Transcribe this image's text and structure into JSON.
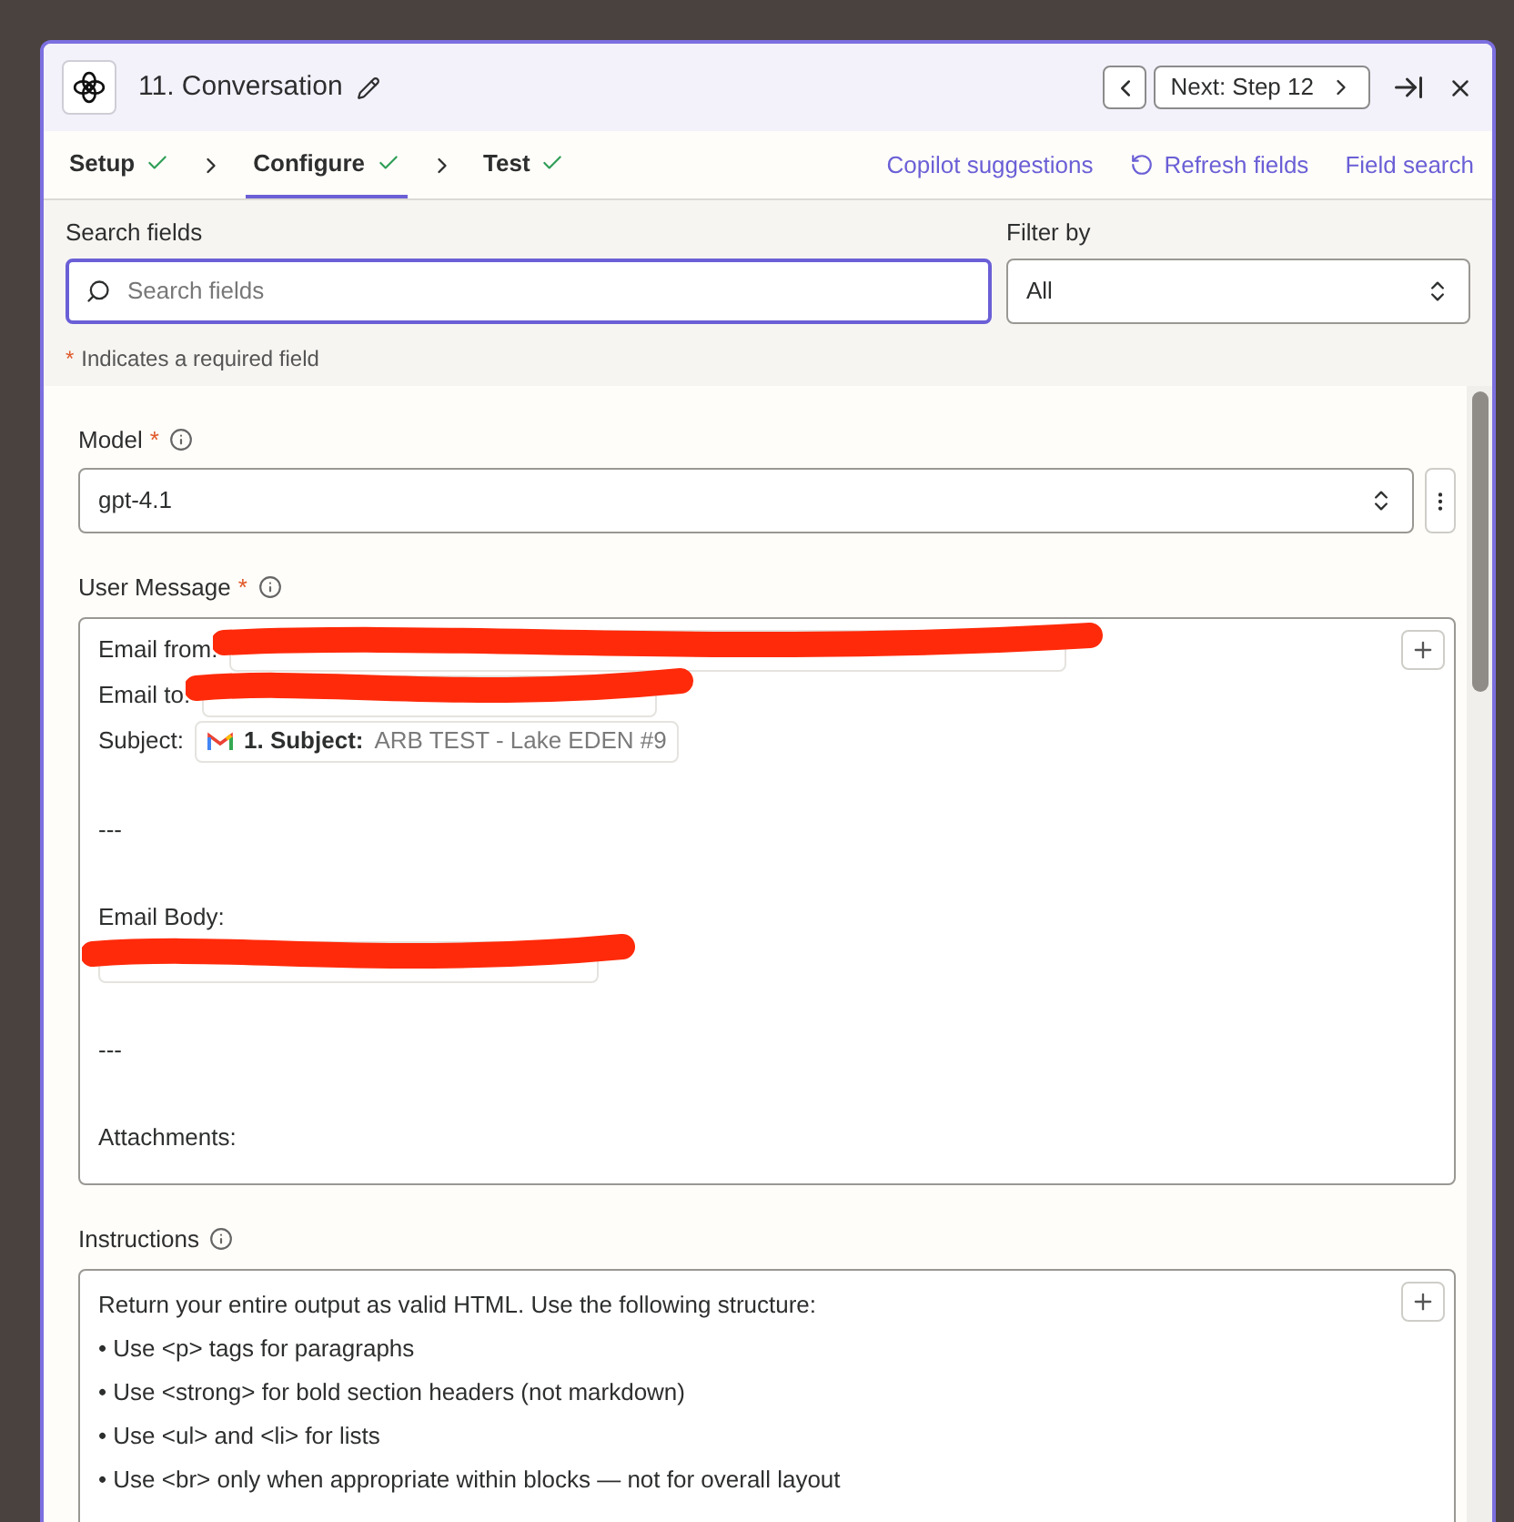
{
  "header": {
    "title": "11. Conversation",
    "next_button": "Next: Step 12"
  },
  "steps": [
    {
      "label": "Setup",
      "done": true,
      "selected": false
    },
    {
      "label": "Configure",
      "done": true,
      "selected": true
    },
    {
      "label": "Test",
      "done": true,
      "selected": false
    }
  ],
  "actions": [
    {
      "label": "Copilot suggestions",
      "kind": "plain"
    },
    {
      "label": "Refresh fields",
      "kind": "refresh"
    },
    {
      "label": "Field search",
      "kind": "plain"
    }
  ],
  "search": {
    "label": "Search fields",
    "placeholder": "Search fields"
  },
  "filter": {
    "label": "Filter by",
    "value": "All"
  },
  "required_note": {
    "mark": "*",
    "text": "Indicates a required field"
  },
  "model": {
    "label": "Model",
    "required": true,
    "value": "gpt-4.1"
  },
  "user_message": {
    "label": "User Message",
    "required": true,
    "lines": [
      {
        "kind": "field",
        "label": "Email from:",
        "pill": {
          "redacted": true
        }
      },
      {
        "kind": "field",
        "label": "Email to:",
        "pill": {
          "redacted": true
        }
      },
      {
        "kind": "field",
        "label": "Subject:",
        "pill": {
          "redacted": false,
          "key": "1. Subject:",
          "value": "ARB TEST - Lake EDEN #9"
        }
      },
      {
        "kind": "blank"
      },
      {
        "kind": "text",
        "text": "---"
      },
      {
        "kind": "blank"
      },
      {
        "kind": "text",
        "text": "Email Body:"
      },
      {
        "kind": "pill",
        "pill": {
          "redacted": true
        }
      },
      {
        "kind": "blank"
      },
      {
        "kind": "text",
        "text": "---"
      },
      {
        "kind": "blank"
      },
      {
        "kind": "text",
        "text": "Attachments:"
      }
    ]
  },
  "instructions": {
    "label": "Instructions",
    "required": false,
    "lines": [
      "Return your entire output as valid HTML. Use the following structure:",
      "• Use <p> tags for paragraphs",
      "• Use <strong> for bold section headers (not markdown)",
      "• Use <ul> and <li> for lists",
      "• Use <br> only when appropriate within blocks — not for overall layout"
    ]
  }
}
